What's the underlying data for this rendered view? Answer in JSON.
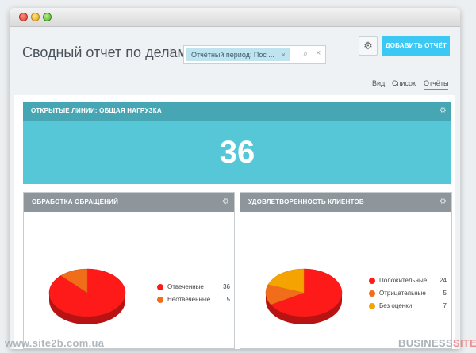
{
  "header": {
    "title": "Сводный отчет по делам",
    "filter_chip": "Отчётный период: Пос ...",
    "add_button": "ДОБАВИТЬ ОТЧЁТ"
  },
  "view": {
    "label": "Вид:",
    "list": "Список",
    "reports": "Отчёты"
  },
  "widgets": {
    "open_lines": {
      "title": "ОТКРЫТЫЕ ЛИНИИ: ОБЩАЯ НАГРУЗКА",
      "value": "36"
    },
    "processing": {
      "title": "ОБРАБОТКА ОБРАЩЕНИЙ",
      "items": [
        {
          "label": "Отвеченные",
          "value": "36",
          "color": "#ff1a1a"
        },
        {
          "label": "Неотвеченные",
          "value": "5",
          "color": "#f26d1a"
        }
      ]
    },
    "satisfaction": {
      "title": "УДОВЛЕТВОРЕННОСТЬ КЛИЕНТОВ",
      "items": [
        {
          "label": "Положительные",
          "value": "24",
          "color": "#ff1a1a"
        },
        {
          "label": "Отрицательные",
          "value": "5",
          "color": "#f26d1a"
        },
        {
          "label": "Без оценки",
          "value": "7",
          "color": "#f5a300"
        }
      ]
    }
  },
  "chart_data": [
    {
      "type": "pie",
      "title": "ОБРАБОТКА ОБРАЩЕНИЙ",
      "categories": [
        "Отвеченные",
        "Неотвеченные"
      ],
      "values": [
        36,
        5
      ]
    },
    {
      "type": "pie",
      "title": "УДОВЛЕТВОРЕННОСТЬ КЛИЕНТОВ",
      "categories": [
        "Положительные",
        "Отрицательные",
        "Без оценки"
      ],
      "values": [
        24,
        5,
        7
      ]
    }
  ],
  "watermark": {
    "site": "www.site2b.com.ua",
    "brand_part1": "BUSINESS",
    "brand_part2": "SITE"
  }
}
